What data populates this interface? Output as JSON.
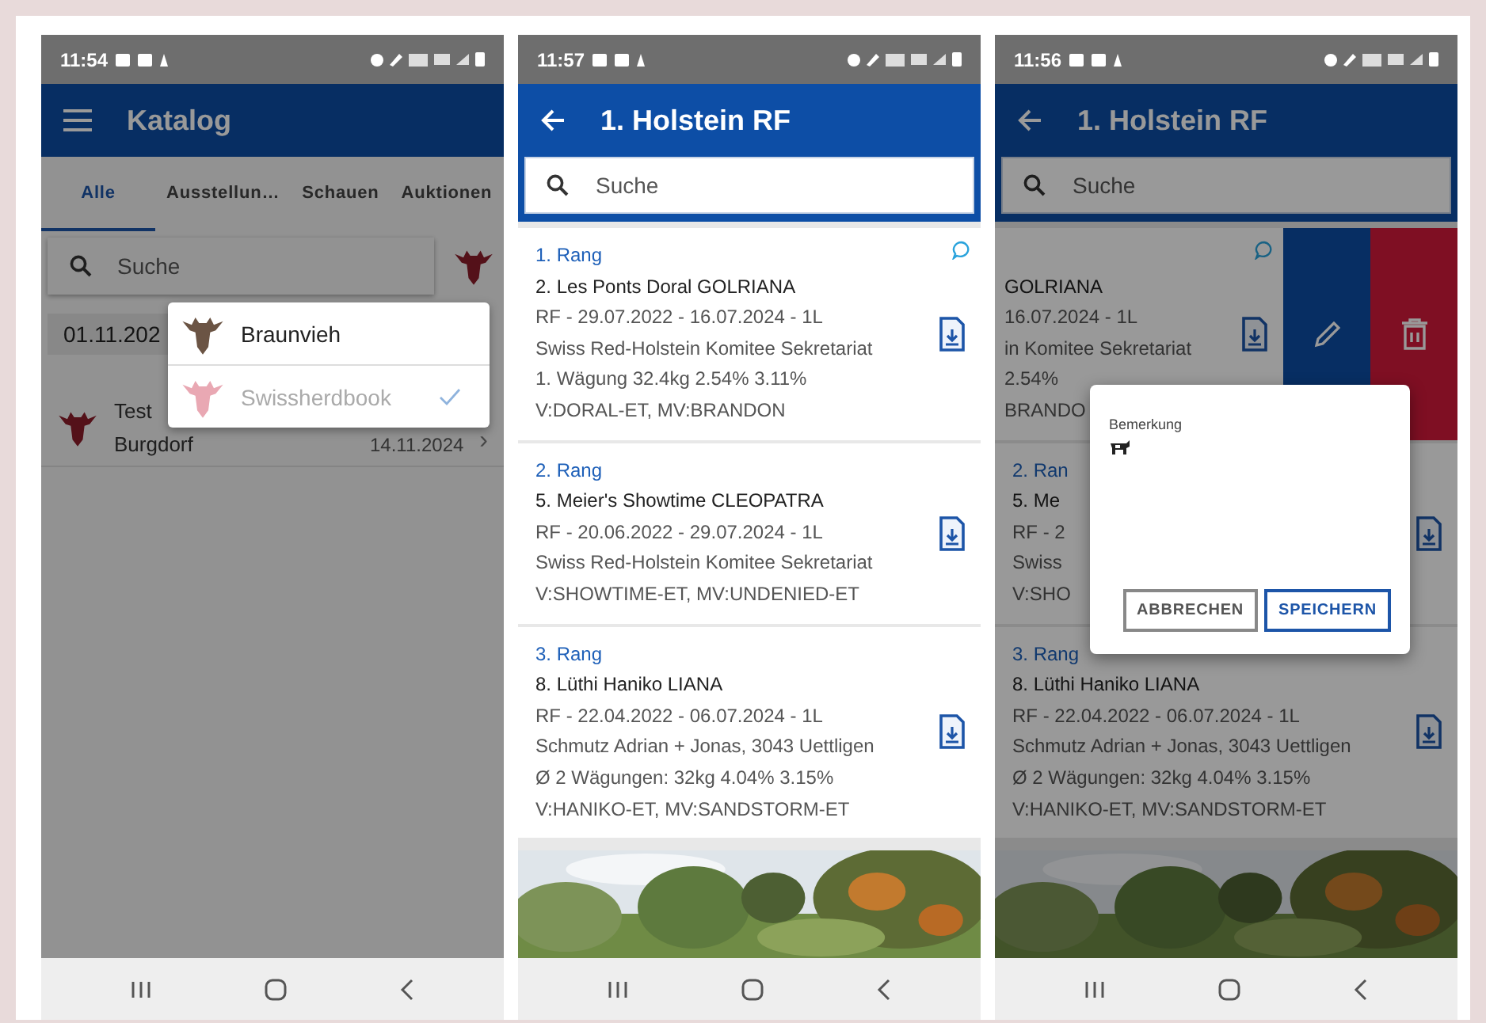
{
  "screens": [
    {
      "kind": "catalog",
      "time": "11:54",
      "dimmed": true,
      "title": "Katalog",
      "tabs": [
        {
          "label": "Alle",
          "selected": true
        },
        {
          "label": "Ausstellun…",
          "selected": false
        },
        {
          "label": "Schauen",
          "selected": false
        },
        {
          "label": "Auktionen",
          "selected": false
        }
      ],
      "search": {
        "placeholder": "Suche"
      },
      "date_chip": "01.11.202",
      "items": [
        {
          "title": "Test",
          "subtitle": "Burgdorf",
          "date": "14.11.2024",
          "chevron": "›"
        }
      ],
      "menu": [
        {
          "label": "Braunvieh",
          "selected": false,
          "color": "#6b5444"
        },
        {
          "label": "Swissherdbook",
          "selected": true,
          "color": "#e9a8b3"
        }
      ]
    },
    {
      "kind": "detail",
      "time": "11:57",
      "dimmed": false,
      "title": "1. Holstein RF",
      "search": {
        "placeholder": "Suche"
      },
      "cards": [
        {
          "rank": "1. Rang",
          "name": "2. Les Ponts Doral GOLRIANA",
          "lines": [
            "RF - 29.07.2022 - 16.07.2024 - 1L",
            "Swiss Red-Holstein Komitee Sekretariat",
            "1. Wägung 32.4kg 2.54% 3.11%",
            "V:DORAL-ET, MV:BRANDON"
          ],
          "comment": true,
          "swiped": false
        },
        {
          "rank": "2. Rang",
          "name": "5. Meier's Showtime CLEOPATRA",
          "lines": [
            "RF - 20.06.2022 - 29.07.2024 - 1L",
            "Swiss Red-Holstein Komitee Sekretariat",
            "V:SHOWTIME-ET, MV:UNDENIED-ET"
          ],
          "comment": false,
          "swiped": false
        },
        {
          "rank": "3. Rang",
          "name": "8. Lüthi Haniko LIANA",
          "lines": [
            "RF - 22.04.2022 - 06.07.2024 - 1L",
            "Schmutz Adrian + Jonas, 3043 Uettligen",
            "Ø 2 Wägungen: 32kg 4.04% 3.15%",
            "V:HANIKO-ET, MV:SANDSTORM-ET"
          ],
          "comment": false,
          "swiped": false
        }
      ]
    },
    {
      "kind": "detail",
      "time": "11:56",
      "dimmed": true,
      "title": "1. Holstein RF",
      "search": {
        "placeholder": "Suche"
      },
      "cards": [
        {
          "name": "GOLRIANA",
          "lines": [
            "16.07.2024 - 1L",
            "in Komitee Sekretariat",
            "2.54%",
            "BRANDO"
          ],
          "comment": true,
          "swiped": true
        },
        {
          "rank": "2. Ran",
          "name": "5. Me",
          "lines": [
            "RF - 2",
            "Swiss",
            "V:SHO"
          ],
          "comment": false,
          "swiped": false
        },
        {
          "rank": "3. Rang",
          "name": "8. Lüthi Haniko LIANA",
          "lines": [
            "RF - 22.04.2022 - 06.07.2024 - 1L",
            "Schmutz Adrian + Jonas, 3043 Uettligen",
            "Ø 2 Wägungen: 32kg 4.04% 3.15%",
            "V:HANIKO-ET, MV:SANDSTORM-ET"
          ],
          "comment": false,
          "swiped": false
        }
      ],
      "dialog": {
        "label": "Bemerkung",
        "buttons": [
          {
            "label": "ABBRECHEN",
            "primary": false
          },
          {
            "label": "SPEICHERN",
            "primary": true
          }
        ]
      }
    }
  ]
}
